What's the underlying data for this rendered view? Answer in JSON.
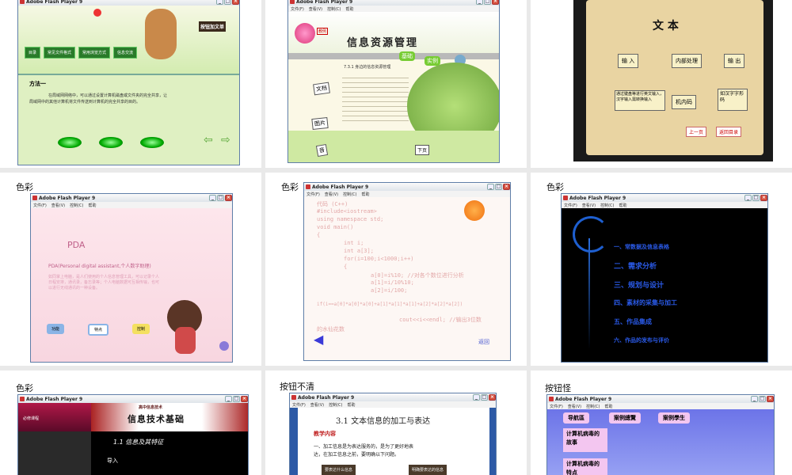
{
  "window_title": "Adobe Flash Player 9",
  "menu": [
    "文件(F)",
    "查看(V)",
    "控制(C)",
    "帮助"
  ],
  "captions": {
    "c4": "色彩",
    "c5": "色彩",
    "c6": "色彩",
    "c7": "色彩",
    "c8": "按钮不清",
    "c9": "按钮怪"
  },
  "p1": {
    "tabs": [
      "目录",
      "常见文件格式",
      "常用浏览方式",
      "信息交流"
    ],
    "sign": "按钮加文单",
    "heading": "方法一",
    "body1": "在局域网网络中，可以通过设置计算机磁盘或文件夹的完全共享，让",
    "body2": "局域网中的其他计算机将文件传送到计算机的完全共享的目的。"
  },
  "p2": {
    "title": "信息资源管理",
    "sub": "7.3.1 身边的信息资源管理",
    "tabs": [
      "基础",
      "实例"
    ],
    "labels": [
      "文档",
      "图片",
      "音",
      "下页"
    ],
    "stamp": "教例"
  },
  "p3": {
    "title": "文 本",
    "boxes": [
      "输 入",
      "内部处理",
      "输 出",
      "通过键盘等进行英文输入，汉字输入需转换输入",
      "机内码",
      "如汉字字形码"
    ],
    "nav": [
      "上一页",
      "返回目录"
    ]
  },
  "p4": {
    "title": "PDA",
    "sub": "PDA(Personal digital assistant,个人数字助理)",
    "body": "如同掌上电脑，是人们使用的个人信息管理工具，可以记录个人日程安排，通讯录，备忘录等；个人电脑数据可互相传输，也可以进行无线通讯的一种设备。",
    "btns": [
      "功能",
      "特点",
      "控制"
    ]
  },
  "p5": {
    "lines": [
      "代码 (C++)",
      "#include<iostream>",
      "using namespace std;",
      "void main()",
      "{",
      "int i;",
      "int a[3];",
      "for(i=100;i<1000;i++)",
      "{",
      "a[0]=i%10;  //对各个数位进行分析",
      "a[1]=i/10%10;",
      "a[2]=i/100;",
      "if(i==a[0]*a[0]*a[0]+a[1]*a[1]*a[1]+a[2]*a[2]*a[2])",
      "cout<<i<<endl; //输出3位数",
      "的水仙花数"
    ],
    "back": "返回"
  },
  "p6": {
    "items": [
      "一、常数据及信息表格",
      "二、需求分析",
      "三、规划与设计",
      "四、素材的采集与加工",
      "五、作品集成",
      "六、作品的发布与评价"
    ]
  },
  "p7": {
    "top": "高中信息技术",
    "title": "信息技术基础",
    "left": "必修课程",
    "sec": "1.1 信息及其特征",
    "intro": "导入"
  },
  "p8": {
    "title": "3.1 文本信息的加工与表达",
    "sub": "教学内容",
    "body1": "一、加工信息是为表达服务的，是为了更好地表",
    "body2": "达，在加工信息之前，要明确以下问题。",
    "b1": "要表达什么信息",
    "b2": "明确要表达的信息"
  },
  "p9": {
    "tabs": [
      "导航區",
      "案例總覽",
      "案例學生"
    ],
    "items": [
      "计算机病毒的故事",
      "计算机病毒的特点"
    ]
  }
}
